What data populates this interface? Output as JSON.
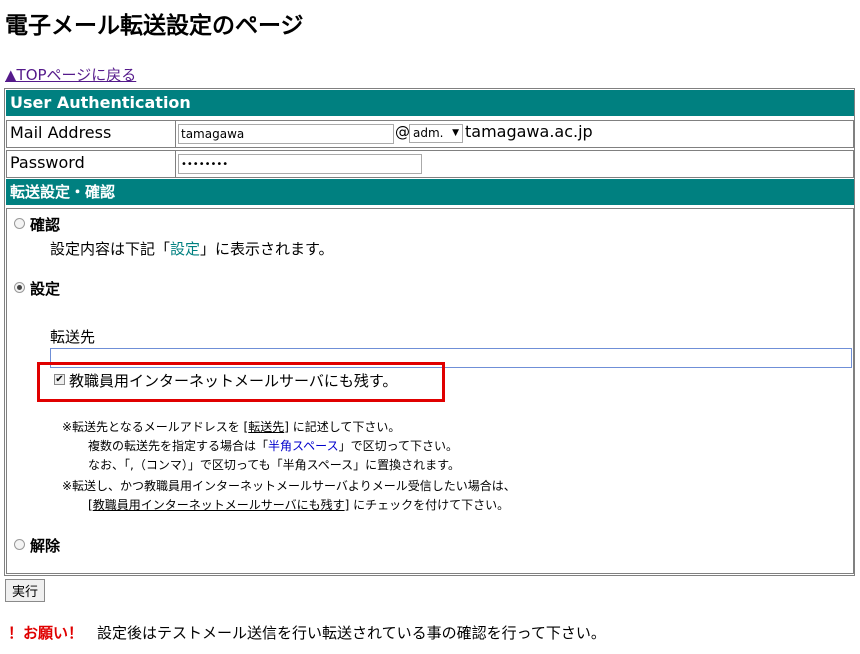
{
  "page_title": "電子メール転送設定のページ",
  "top_link": "▲TOPページに戻る",
  "auth": {
    "header": "User Authentication",
    "mail_label": "Mail Address",
    "mail_value": "tamagawa",
    "at_sign": "@",
    "domain_select": "adm.",
    "domain_suffix": "tamagawa.ac.jp",
    "password_label": "Password",
    "password_value": "••••••••"
  },
  "forward": {
    "header": "転送設定・確認",
    "option_confirm": "確認",
    "confirm_desc_pre": "設定内容は下記「",
    "confirm_desc_link": "設定",
    "confirm_desc_post": "」に表示されます。",
    "option_set": "設定",
    "dest_label": "転送先",
    "dest_value": "",
    "keep_checkbox_label": "教職員用インターネットメールサーバにも残す。",
    "keep_checked": true,
    "note1_a": "※転送先となるメールアドレスを [",
    "note1_b": "転送先",
    "note1_c": "] に記述して下さい。",
    "note2_a": "複数の転送先を指定する場合は「",
    "note2_b": "半角スペース",
    "note2_c": "」で区切って下さい。",
    "note3": "なお、「,（コンマ）」で区切っても「半角スペース」に置換されます。",
    "note4": "※転送し、かつ教職員用インターネットメールサーバよりメール受信したい場合は、",
    "note5_a": "[",
    "note5_b": "教職員用インターネットメールサーバにも残す",
    "note5_c": "] にチェックを付けて下さい。",
    "option_release": "解除",
    "selected_option": "設定"
  },
  "execute_button": "実行",
  "footer": {
    "warning": "！お願い！",
    "message": "設定後はテストメール送信を行い転送されている事の確認を行って下さい。"
  },
  "colors": {
    "header_band": "#008080",
    "highlight_border": "#e00000",
    "warning": "#e00000"
  }
}
